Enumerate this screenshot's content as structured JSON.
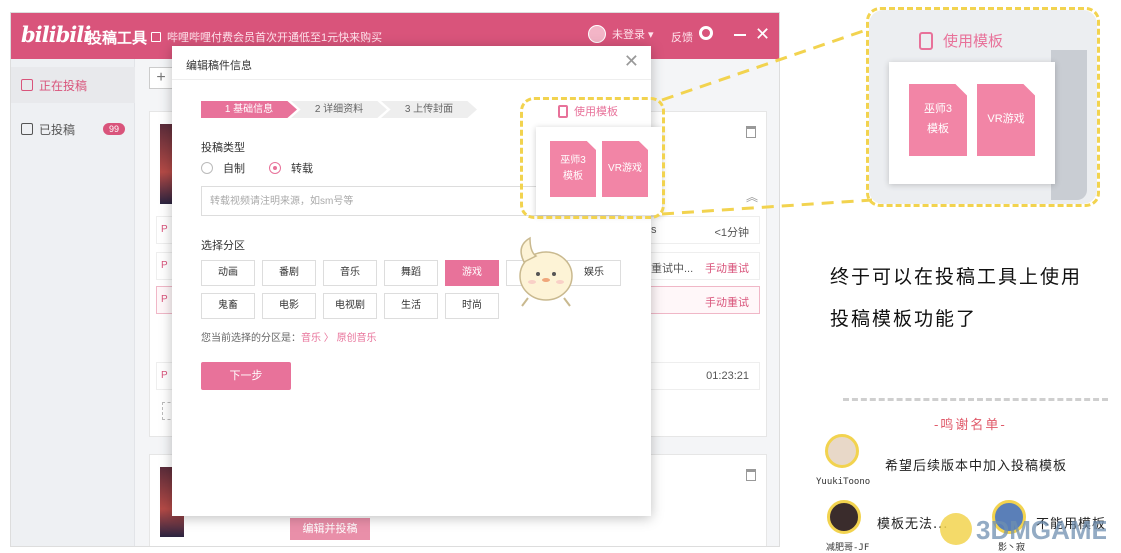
{
  "app": {
    "logo_text": "bilibili",
    "logo_subtitle": "投稿工具",
    "notice": "哔哩哔哩付费会员首次开通低至1元快来购买",
    "login_status": "未登录 ▾",
    "feedback": "反馈",
    "minimize": "—",
    "close": "✕"
  },
  "sidebar": {
    "items": [
      {
        "label": "正在投稿",
        "active": true
      },
      {
        "label": "已投稿",
        "badge": "99"
      }
    ]
  },
  "main": {
    "add": "+",
    "collapse": "︽",
    "rows": [
      {
        "prefix": "P",
        "text": "s",
        "action": "<1分钟"
      },
      {
        "prefix": "P",
        "text": "重试中...",
        "action": "手动重试"
      },
      {
        "prefix": "P",
        "text": "",
        "action": "手动重试"
      },
      {
        "prefix": "P",
        "text": "",
        "action": "01:23:21"
      }
    ],
    "edit_button": "编辑并投稿"
  },
  "modal": {
    "title": "编辑稿件信息",
    "close": "✕",
    "steps": [
      "1 基础信息",
      "2 详细资料",
      "3 上传封面"
    ],
    "type_label": "投稿类型",
    "type_options": [
      "自制",
      "转载"
    ],
    "type_selected": "转载",
    "source_placeholder": "转载视频请注明来源，如sm号等",
    "zone_label": "选择分区",
    "zones": [
      "动画",
      "番剧",
      "音乐",
      "舞蹈",
      "游戏",
      "科技",
      "娱乐",
      "鬼畜",
      "电影",
      "电视剧",
      "生活",
      "时尚"
    ],
    "zone_selected": "游戏",
    "current_zone_prefix": "您当前选择的分区是：",
    "current_zone": "音乐",
    "current_zone_sep": "〉",
    "current_zone_sub": "原创音乐",
    "next_button": "下一步",
    "template_link": "使用模板",
    "templates": [
      "巫师3 模板",
      "VR游戏"
    ]
  },
  "callout": {
    "template_link": "使用模板",
    "templates": [
      "巫师3 模板",
      "VR游戏"
    ]
  },
  "annotation": {
    "line1": "终于可以在投稿工具上使用",
    "line2": "投稿模板功能了",
    "thanks_title": "-鸣谢名单-",
    "users": [
      {
        "name": "YuukiToono",
        "comment": "希望后续版本中加入投稿模板"
      },
      {
        "name": "减肥哥-JF",
        "comment": "模板无法..."
      },
      {
        "name": "影丶寂",
        "comment": "不能用模板"
      }
    ],
    "watermark": "3DMGAME"
  },
  "colors": {
    "brand": "#d9547b",
    "accent": "#e8729a",
    "highlight": "#f2d34f"
  }
}
